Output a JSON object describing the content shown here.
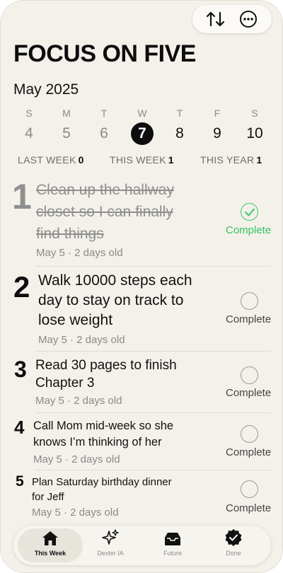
{
  "header": {
    "title": "FOCUS ON FIVE",
    "month": "May 2025",
    "toolbar_icons": [
      "sort-arrows-icon",
      "more-ellipsis-icon"
    ]
  },
  "week": {
    "days": [
      {
        "dow": "S",
        "num": "4"
      },
      {
        "dow": "M",
        "num": "5"
      },
      {
        "dow": "T",
        "num": "6"
      },
      {
        "dow": "W",
        "num": "7"
      },
      {
        "dow": "T",
        "num": "8"
      },
      {
        "dow": "F",
        "num": "9"
      },
      {
        "dow": "S",
        "num": "10"
      }
    ],
    "today_index": 3
  },
  "stats": {
    "last_week_label": "LAST WEEK",
    "last_week": "0",
    "this_week_label": "THIS WEEK",
    "this_week": "1",
    "this_year_label": "THIS YEAR",
    "this_year": "1"
  },
  "tasks": [
    {
      "index": "1",
      "lines": [
        "Clean up the hallway",
        "closet so I can finally",
        "find things"
      ],
      "meta": "May 5 · 2 days old",
      "status": "Complete",
      "done": true
    },
    {
      "index": "2",
      "lines": [
        "Walk 10000 steps each",
        "day to stay on track to",
        "lose weight"
      ],
      "meta": "May 5 · 2 days old",
      "status": "Complete",
      "done": false
    },
    {
      "index": "3",
      "lines": [
        "Read 30 pages to finish",
        "Chapter 3"
      ],
      "meta": "May 5 · 2 days old",
      "status": "Complete",
      "done": false
    },
    {
      "index": "4",
      "lines": [
        "Call Mom mid-week so she",
        "knows I’m thinking of her"
      ],
      "meta": "May 5 · 2 days old",
      "status": "Complete",
      "done": false
    },
    {
      "index": "5",
      "lines": [
        "Plan Saturday birthday dinner",
        "for Jeff"
      ],
      "meta": "May 5 · 2 days old",
      "status": "Complete",
      "done": false
    }
  ],
  "tabs": [
    {
      "label": "This Week",
      "icon": "house-icon"
    },
    {
      "label": "Dexter IA",
      "icon": "sparkles-icon"
    },
    {
      "label": "Future",
      "icon": "tray-icon"
    },
    {
      "label": "Done",
      "icon": "checkmark-seal-icon"
    }
  ],
  "colors": {
    "background": "#f3f1ea",
    "complete_green": "#34c262",
    "today_fill": "#0d0d0d"
  }
}
